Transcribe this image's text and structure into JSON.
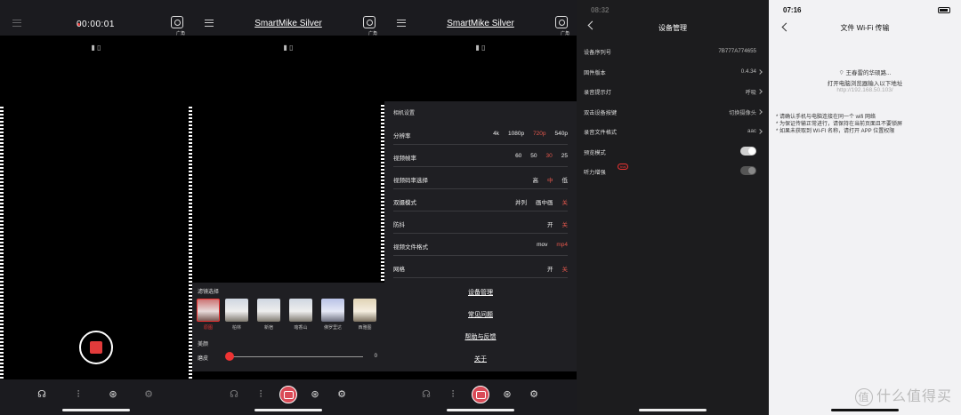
{
  "p1": {
    "rec_time": "00:00:01",
    "cam_label": "广角",
    "devices": "▮ ▯"
  },
  "p2": {
    "title": "SmartMike Silver",
    "cam_label": "广角",
    "devices": "▮ ▯",
    "filter": {
      "header": "滤镜选择",
      "beauty_header": "美颜",
      "slider_label": "磨皮",
      "slider_value": "0",
      "thumbs": [
        "原图",
        "柏林",
        "新宿",
        "喀香山",
        "佛罗里达",
        "西雅图"
      ]
    }
  },
  "p3": {
    "title": "SmartMike Silver",
    "cam_label": "广角",
    "settings_header": "相机设置",
    "rows": [
      {
        "label": "分辨率",
        "opts": [
          "4k",
          "1080p",
          "720p",
          "540p"
        ],
        "on": 2
      },
      {
        "label": "视频帧率",
        "opts": [
          "60",
          "50",
          "30",
          "25"
        ],
        "on": 2
      },
      {
        "label": "视频码率选择",
        "opts": [
          "高",
          "中",
          "低"
        ],
        "on": 1
      },
      {
        "label": "双摄模式",
        "opts": [
          "并列",
          "画中画",
          "关"
        ],
        "on": 2
      },
      {
        "label": "防抖",
        "opts": [
          "开",
          "关"
        ],
        "on": 1
      },
      {
        "label": "视频文件格式",
        "opts": [
          "mov",
          "mp4"
        ],
        "on": 1
      },
      {
        "label": "网格",
        "opts": [
          "开",
          "关"
        ],
        "on": 1
      }
    ],
    "links": [
      "设备管理",
      "常见问题",
      "帮助与反馈",
      "关于"
    ]
  },
  "p4": {
    "title": "设备管理",
    "status_time": "08:32",
    "rows": [
      {
        "label": "设备序列号",
        "value": "7B777A774655"
      },
      {
        "label": "固件版本",
        "value": "0.4.34"
      },
      {
        "label": "录音提示灯",
        "value": "呼吸"
      },
      {
        "label": "双击设备按键",
        "value": "切换摄像头"
      },
      {
        "label": "录音文件格式",
        "value": "aac"
      },
      {
        "label": "预览模式",
        "value": ""
      },
      {
        "label": "听力增强",
        "value": "",
        "badge": "trial"
      }
    ]
  },
  "p5": {
    "status_time": "07:16",
    "title": "文件 Wi-Fi 传输",
    "network": "王春雷的华硕路...",
    "instruction": "打开电脑浏览器输入以下地址",
    "url": "http://192.168.50.103/",
    "notes": [
      "* 请确认手机与电脑连接在同一个 wifi 网络",
      "* 为保证传输正常进行，请保持在当前页面且不要锁屏",
      "* 如果未获取到 WI-FI 名称，请打开 APP 位置权限"
    ],
    "watermark": "什么值得买",
    "watermark_logo": "值"
  }
}
